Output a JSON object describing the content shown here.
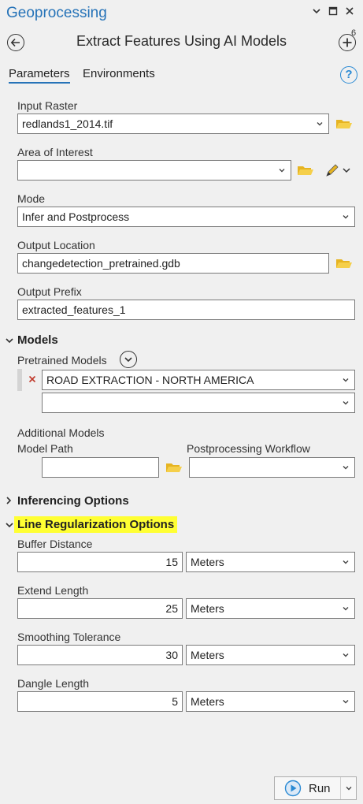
{
  "pane": {
    "title": "Geoprocessing"
  },
  "tool": {
    "title": "Extract Features Using AI Models",
    "add_badge": "6"
  },
  "tabs": [
    {
      "label": "Parameters",
      "active": true
    },
    {
      "label": "Environments",
      "active": false
    }
  ],
  "params": {
    "input_raster": {
      "label": "Input Raster",
      "value": "redlands1_2014.tif"
    },
    "area_of_interest": {
      "label": "Area of Interest",
      "value": ""
    },
    "mode": {
      "label": "Mode",
      "value": "Infer and Postprocess"
    },
    "output_location": {
      "label": "Output Location",
      "value": "changedetection_pretrained.gdb"
    },
    "output_prefix": {
      "label": "Output Prefix",
      "value": "extracted_features_1"
    }
  },
  "models": {
    "header": "Models",
    "pretrained_label": "Pretrained Models",
    "pretrained_value": "ROAD EXTRACTION - NORTH AMERICA",
    "pretrained_empty": "",
    "additional_label": "Additional Models",
    "model_path_label": "Model Path",
    "model_path_value": "",
    "postprocessing_label": "Postprocessing Workflow",
    "postprocessing_value": ""
  },
  "inferencing": {
    "header": "Inferencing Options"
  },
  "line_reg": {
    "header": "Line Regularization Options",
    "buffer": {
      "label": "Buffer Distance",
      "value": "15",
      "unit": "Meters"
    },
    "extend": {
      "label": "Extend Length",
      "value": "25",
      "unit": "Meters"
    },
    "smoothing": {
      "label": "Smoothing Tolerance",
      "value": "30",
      "unit": "Meters"
    },
    "dangle": {
      "label": "Dangle Length",
      "value": "5",
      "unit": "Meters"
    }
  },
  "footer": {
    "run_label": "Run"
  },
  "colors": {
    "accent": "#2673b8",
    "highlight": "#ffff33",
    "folder": "#e6b422",
    "remove": "#c0392b"
  }
}
